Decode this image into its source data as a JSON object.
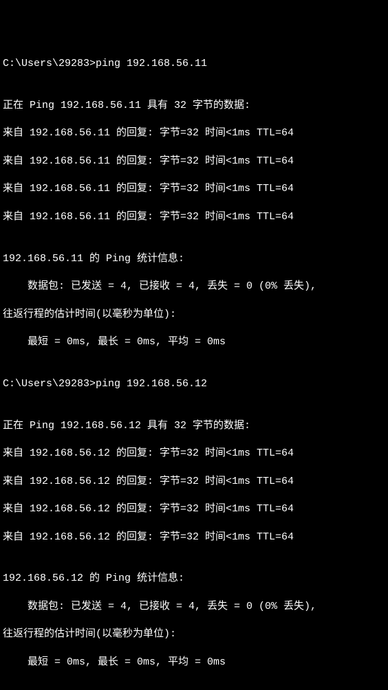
{
  "prompt1": "C:\\Users\\29283>",
  "cmd1": "ping 192.168.56.11",
  "blank": "",
  "ping1_header": "正在 Ping 192.168.56.11 具有 32 字节的数据:",
  "ping1_reply1": "来自 192.168.56.11 的回复: 字节=32 时间<1ms TTL=64",
  "ping1_reply2": "来自 192.168.56.11 的回复: 字节=32 时间<1ms TTL=64",
  "ping1_reply3": "来自 192.168.56.11 的回复: 字节=32 时间<1ms TTL=64",
  "ping1_reply4": "来自 192.168.56.11 的回复: 字节=32 时间<1ms TTL=64",
  "ping1_stats_header": "192.168.56.11 的 Ping 统计信息:",
  "ping1_packets": "    数据包: 已发送 = 4, 已接收 = 4, 丢失 = 0 (0% 丢失),",
  "ping1_rtt_header": "往返行程的估计时间(以毫秒为单位):",
  "ping1_rtt": "    最短 = 0ms, 最长 = 0ms, 平均 = 0ms",
  "prompt2": "C:\\Users\\29283>",
  "cmd2": "ping 192.168.56.12",
  "ping2_header": "正在 Ping 192.168.56.12 具有 32 字节的数据:",
  "ping2_reply1": "来自 192.168.56.12 的回复: 字节=32 时间<1ms TTL=64",
  "ping2_reply2": "来自 192.168.56.12 的回复: 字节=32 时间<1ms TTL=64",
  "ping2_reply3": "来自 192.168.56.12 的回复: 字节=32 时间<1ms TTL=64",
  "ping2_reply4": "来自 192.168.56.12 的回复: 字节=32 时间<1ms TTL=64",
  "ping2_stats_header": "192.168.56.12 的 Ping 统计信息:",
  "ping2_packets": "    数据包: 已发送 = 4, 已接收 = 4, 丢失 = 0 (0% 丢失),",
  "ping2_rtt_header": "往返行程的估计时间(以毫秒为单位):",
  "ping2_rtt": "    最短 = 0ms, 最长 = 0ms, 平均 = 0ms"
}
